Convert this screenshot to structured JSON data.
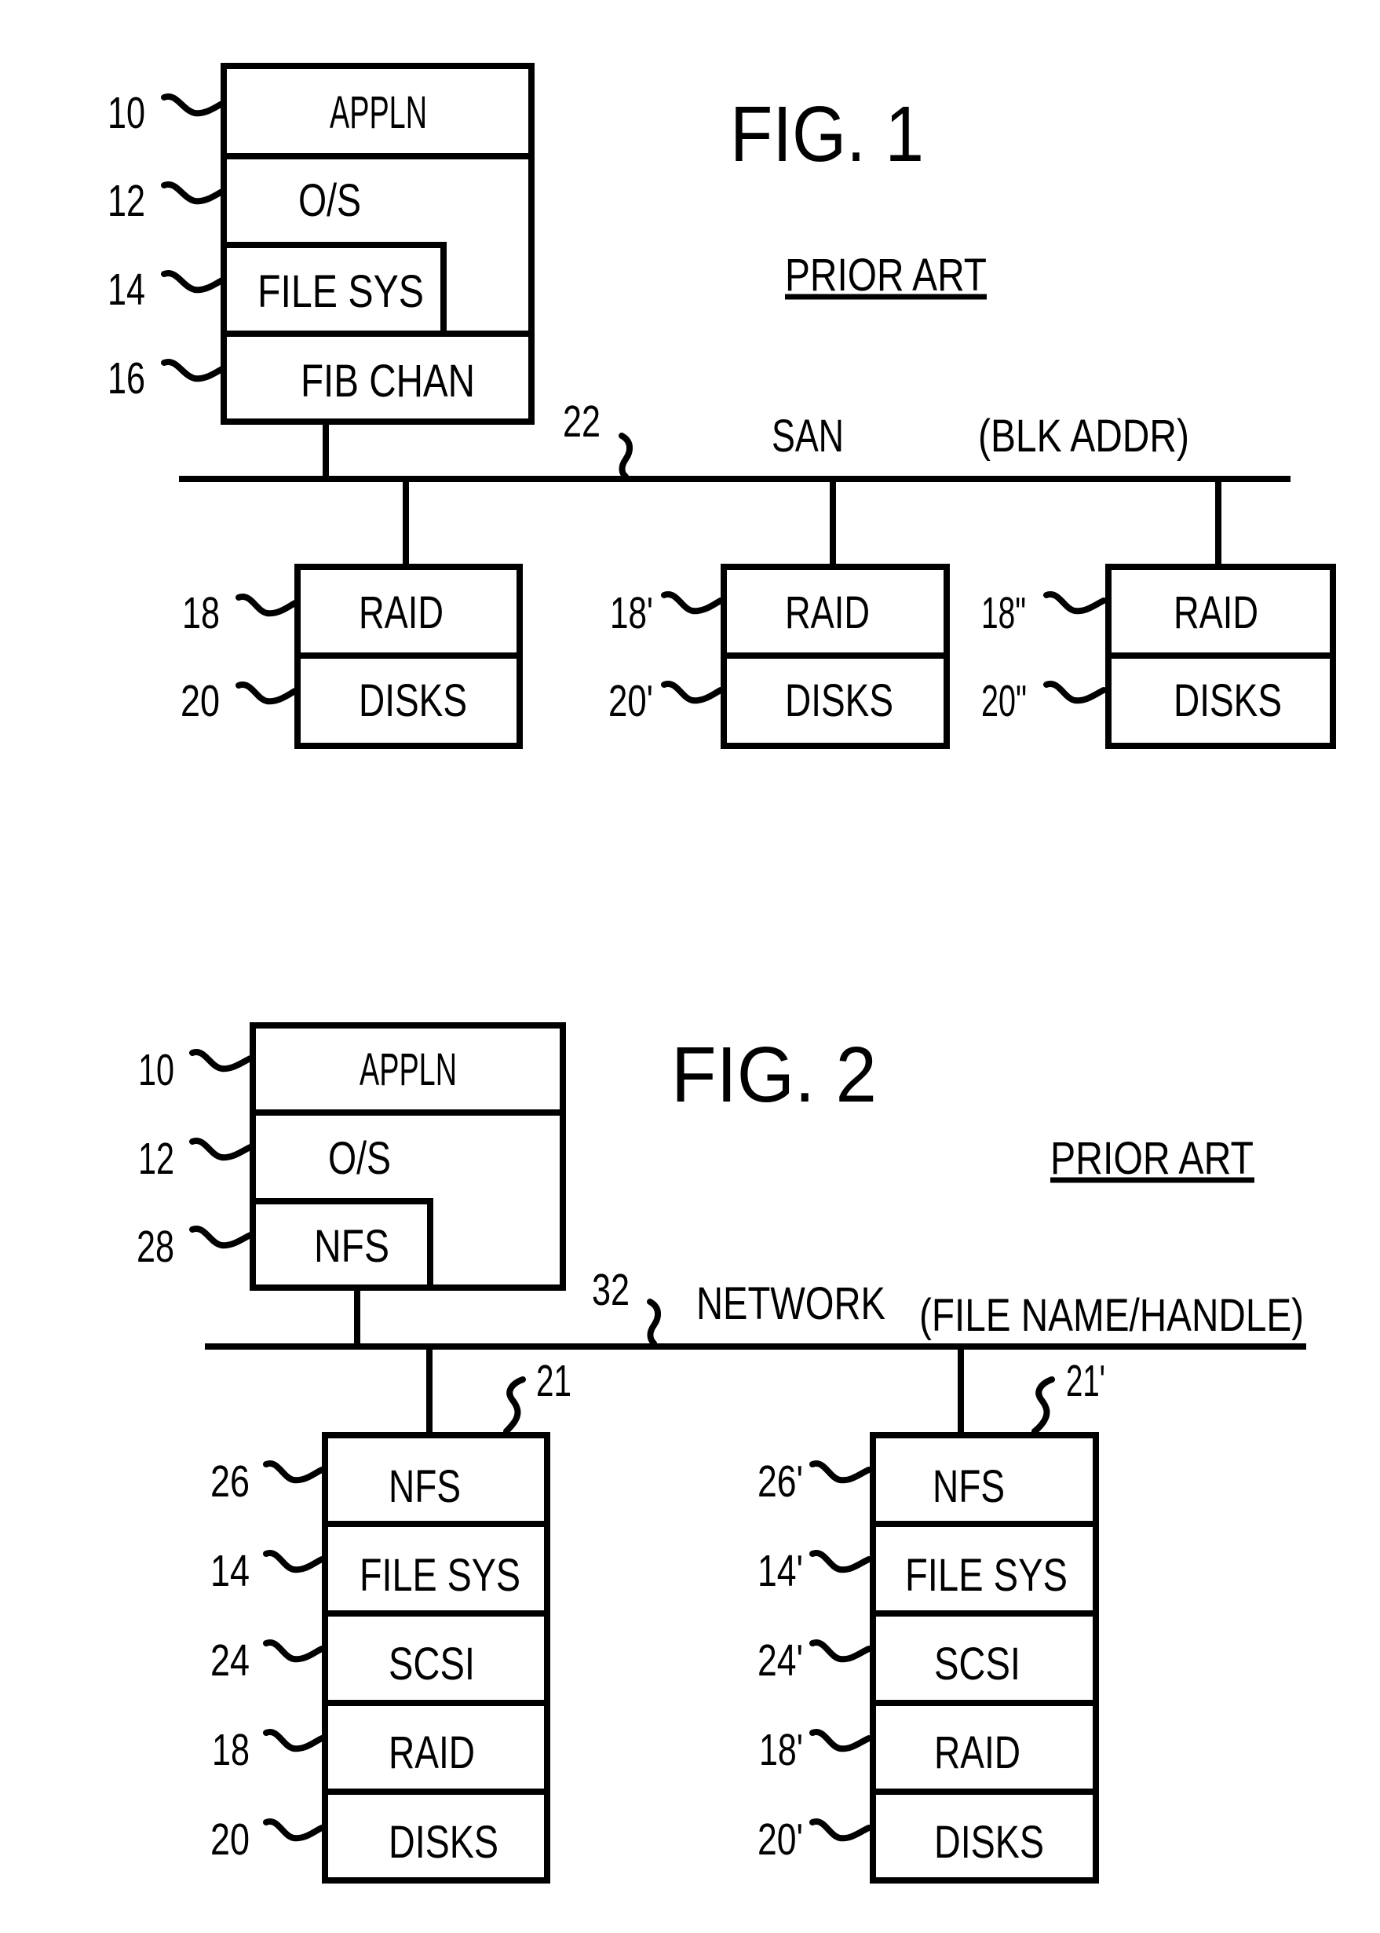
{
  "fig1": {
    "title": "FIG. 1",
    "prior_art": "PRIOR ART",
    "host": {
      "layers": [
        {
          "ref": "10",
          "label": "APPLN"
        },
        {
          "ref": "12",
          "label": "O/S"
        },
        {
          "ref": "14",
          "label": "FILE SYS"
        },
        {
          "ref": "16",
          "label": "FIB CHAN"
        }
      ]
    },
    "bus": {
      "ref": "22",
      "label": "SAN",
      "addressing": "(BLK ADDR)"
    },
    "storage_units": [
      {
        "raid_ref": "18",
        "raid_label": "RAID",
        "disks_ref": "20",
        "disks_label": "DISKS"
      },
      {
        "raid_ref": "18'",
        "raid_label": "RAID",
        "disks_ref": "20'",
        "disks_label": "DISKS"
      },
      {
        "raid_ref": "18\"",
        "raid_label": "RAID",
        "disks_ref": "20\"",
        "disks_label": "DISKS"
      }
    ]
  },
  "fig2": {
    "title": "FIG. 2",
    "prior_art": "PRIOR ART",
    "host": {
      "layers": [
        {
          "ref": "10",
          "label": "APPLN"
        },
        {
          "ref": "12",
          "label": "O/S"
        },
        {
          "ref": "28",
          "label": "NFS"
        }
      ]
    },
    "bus": {
      "ref": "32",
      "label": "NETWORK",
      "addressing": "(FILE NAME/HANDLE)"
    },
    "servers": [
      {
        "ref": "21",
        "layers": [
          {
            "ref": "26",
            "label": "NFS"
          },
          {
            "ref": "14",
            "label": "FILE SYS"
          },
          {
            "ref": "24",
            "label": "SCSI"
          },
          {
            "ref": "18",
            "label": "RAID"
          },
          {
            "ref": "20",
            "label": "DISKS"
          }
        ]
      },
      {
        "ref": "21'",
        "layers": [
          {
            "ref": "26'",
            "label": "NFS"
          },
          {
            "ref": "14'",
            "label": "FILE SYS"
          },
          {
            "ref": "24'",
            "label": "SCSI"
          },
          {
            "ref": "18'",
            "label": "RAID"
          },
          {
            "ref": "20'",
            "label": "DISKS"
          }
        ]
      }
    ]
  }
}
